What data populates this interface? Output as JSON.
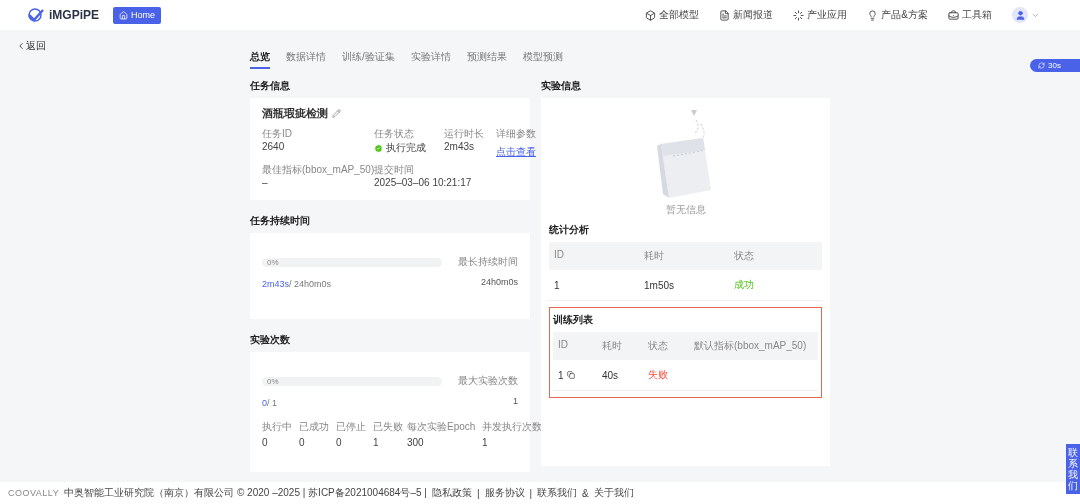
{
  "header": {
    "logo": "iMGPiPE",
    "home": "Home",
    "nav": [
      {
        "label": "全部模型"
      },
      {
        "label": "新闻报道"
      },
      {
        "label": "产业应用"
      },
      {
        "label": "产品&方案"
      },
      {
        "label": "工具箱"
      }
    ]
  },
  "back": "返回",
  "tabs": [
    {
      "label": "总览",
      "selected": true
    },
    {
      "label": "数据详情",
      "selected": false
    },
    {
      "label": "训练/验证集",
      "selected": false
    },
    {
      "label": "实验详情",
      "selected": false
    },
    {
      "label": "预测结果",
      "selected": false
    },
    {
      "label": "模型预测",
      "selected": false
    }
  ],
  "refresh": "30s",
  "side_tab": "联系我们",
  "task_info": {
    "heading": "任务信息",
    "name": "酒瓶瑕疵检测",
    "fields": [
      {
        "label": "任务ID",
        "value": "2640",
        "kind": "text"
      },
      {
        "label": "任务状态",
        "value": "执行完成",
        "kind": "status"
      },
      {
        "label": "运行时长",
        "value": "2m43s",
        "kind": "text"
      },
      {
        "label": "详细参数",
        "value": "点击查看",
        "kind": "link"
      },
      {
        "label": "最佳指标(bbox_mAP_50)",
        "value": "–",
        "kind": "text"
      },
      {
        "label": "提交时间",
        "value": "2025–03–06 10:21:17",
        "kind": "text"
      }
    ]
  },
  "duration": {
    "heading": "任务持续时间",
    "progress": {
      "label": "0%",
      "level": 0
    },
    "current": "2m43s",
    "total": "/ 24h0m0s",
    "max_label": "最长持续时间",
    "max_value": "24h0m0s"
  },
  "experiments": {
    "heading": "实验次数",
    "progress": {
      "label": "0%",
      "level": 0
    },
    "current": "0",
    "total": "/ 1",
    "max_label": "最大实验次数",
    "max_value": "1",
    "stats": [
      {
        "label": "执行中",
        "value": "0"
      },
      {
        "label": "已成功",
        "value": "0"
      },
      {
        "label": "已停止",
        "value": "0"
      },
      {
        "label": "已失败",
        "value": "1"
      },
      {
        "label": "每次实验Epoch",
        "value": "300"
      },
      {
        "label": "并发执行次数",
        "value": "1"
      }
    ]
  },
  "experiment_info": {
    "heading": "实验信息",
    "empty": "暂无信息",
    "stats": {
      "heading": "统计分析",
      "columns": [
        "ID",
        "耗时",
        "状态"
      ],
      "rows": [
        [
          {
            "text": "1",
            "kind": "text"
          },
          {
            "text": "1m50s",
            "kind": "text"
          },
          {
            "text": "成功",
            "kind": "success"
          }
        ]
      ]
    },
    "training": {
      "heading": "训练列表",
      "highlighted": true,
      "columns": [
        "ID",
        "耗时",
        "状态",
        "默认指标(bbox_mAP_50)"
      ],
      "rows": [
        [
          {
            "text": "1",
            "kind": "copy"
          },
          {
            "text": "40s",
            "kind": "text"
          },
          {
            "text": "失败",
            "kind": "failed"
          },
          {
            "text": "",
            "kind": "text"
          }
        ]
      ]
    }
  },
  "footer": [
    {
      "text": "COOVALLY",
      "kind": "brand"
    },
    {
      "text": "中奥智能工业研究院（南京）有限公司 © 2020 –2025 | 苏ICP备2021004684号–5 |",
      "kind": "text"
    },
    {
      "text": "隐私政策",
      "kind": "link"
    },
    {
      "text": "|",
      "kind": "text"
    },
    {
      "text": "服务协议",
      "kind": "link"
    },
    {
      "text": "|",
      "kind": "text"
    },
    {
      "text": "联系我们",
      "kind": "link"
    },
    {
      "text": "&",
      "kind": "text"
    },
    {
      "text": "关于我们",
      "kind": "link"
    }
  ]
}
